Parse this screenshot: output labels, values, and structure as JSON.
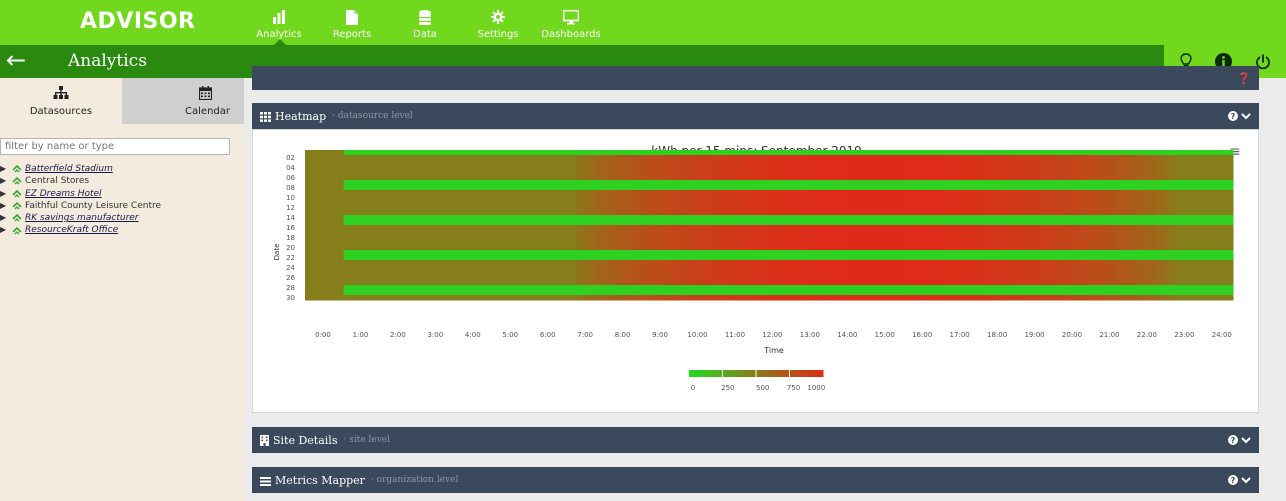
{
  "app": {
    "logo": "ADVISOR",
    "section_title": "Analytics"
  },
  "nav": [
    {
      "label": "Analytics",
      "icon": "bar-chart-icon",
      "active": true
    },
    {
      "label": "Reports",
      "icon": "document-icon",
      "active": false
    },
    {
      "label": "Data",
      "icon": "database-icon",
      "active": false
    },
    {
      "label": "Settings",
      "icon": "gear-icon",
      "active": false
    },
    {
      "label": "Dashboards",
      "icon": "monitor-icon",
      "active": false
    }
  ],
  "header_right_icons": [
    "lightbulb-icon",
    "info-icon",
    "power-icon"
  ],
  "sidebar": {
    "tabs": [
      {
        "label": "Datasources",
        "icon": "hierarchy-icon",
        "active": true
      },
      {
        "label": "Calendar",
        "icon": "calendar-icon",
        "active": false
      }
    ],
    "filter_placeholder": "filter by name or type",
    "items": [
      {
        "label": "Batterfield Stadium",
        "style": "link"
      },
      {
        "label": "Central Stores",
        "style": "plain"
      },
      {
        "label": "EZ Dreams Hotel",
        "style": "link"
      },
      {
        "label": "Faithful County Leisure Centre",
        "style": "plain"
      },
      {
        "label": "RK savings manufacturer",
        "style": "link"
      },
      {
        "label": "ResourceKraft Office",
        "style": "link"
      }
    ]
  },
  "panels": {
    "heatmap": {
      "title": "Heatmap",
      "level": "· datasource level"
    },
    "site_details": {
      "title": "Site Details",
      "level": "· site level"
    },
    "metrics_mapper": {
      "title": "Metrics Mapper",
      "level": "· organization level"
    }
  },
  "colors": {
    "topbar": "#72d81e",
    "subbar": "#2a8a10",
    "panel_header": "#3a4a5c",
    "heat_low": "#22dd22",
    "heat_mid": "#8a7a1a",
    "heat_high": "#e02a18"
  },
  "chart_data": {
    "type": "heatmap",
    "title": "kWh per 15 mins: September 2019",
    "xlabel": "Time",
    "ylabel": "Date",
    "x_ticks": [
      "0:00",
      "1:00",
      "2:00",
      "3:00",
      "4:00",
      "5:00",
      "6:00",
      "7:00",
      "8:00",
      "9:00",
      "10:00",
      "11:00",
      "12:00",
      "13:00",
      "14:00",
      "15:00",
      "16:00",
      "17:00",
      "18:00",
      "19:00",
      "20:00",
      "21:00",
      "22:00",
      "23:00",
      "24:00"
    ],
    "y_ticks": [
      "02",
      "04",
      "06",
      "08",
      "10",
      "12",
      "14",
      "16",
      "18",
      "20",
      "22",
      "24",
      "26",
      "28",
      "30"
    ],
    "y_range": [
      1,
      30
    ],
    "x_range": [
      0,
      24
    ],
    "color_scale": {
      "min": 0,
      "max": 1000,
      "labels": [
        "0",
        "250",
        "500",
        "750",
        "1000"
      ]
    },
    "low_days": [
      1,
      7,
      8,
      14,
      15,
      21,
      22,
      28,
      29
    ],
    "grid": false,
    "legend": "bottom-center"
  }
}
